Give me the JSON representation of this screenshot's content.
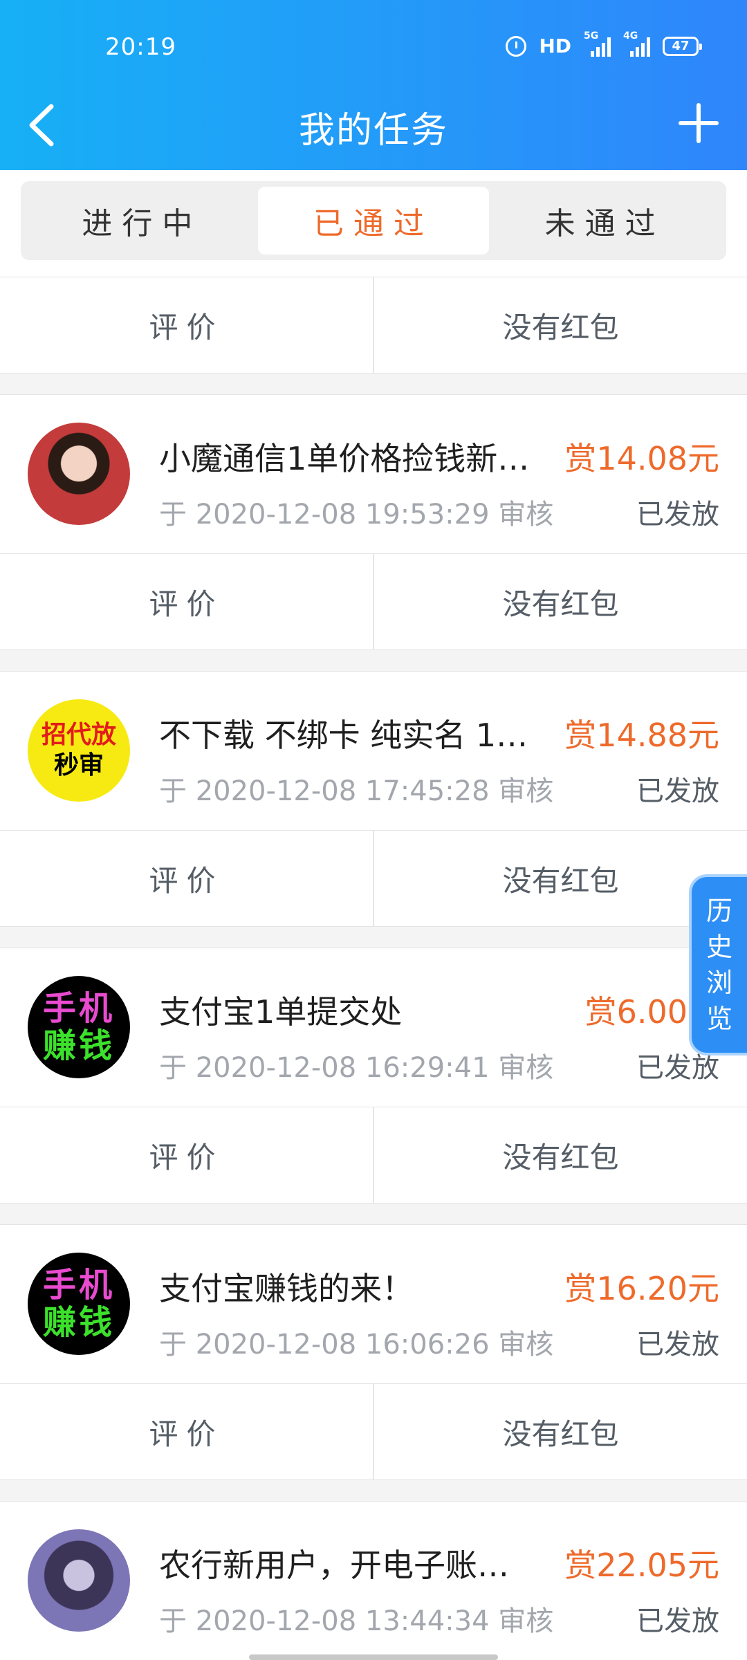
{
  "status": {
    "time": "20:19",
    "hd": "HD",
    "net1": "5G",
    "net2": "4G",
    "battery": "47"
  },
  "header": {
    "title": "我的任务"
  },
  "tabs": [
    {
      "label": "进行中",
      "active": false
    },
    {
      "label": "已通过",
      "active": true
    },
    {
      "label": "未通过",
      "active": false
    }
  ],
  "actions": {
    "rate": "评价",
    "no_redpacket": "没有红包"
  },
  "tasks": [
    {
      "title": "小魔通信1单价格捡钱新…",
      "reward": "赏14.08元",
      "subtitle": "于 2020-12-08 19:53:29 审核",
      "state": "已发放",
      "avatar_icon": "person-photo-avatar"
    },
    {
      "title": "不下载 不绑卡 纯实名 1…",
      "reward": "赏14.88元",
      "subtitle": "于 2020-12-08 17:45:28 审核",
      "state": "已发放",
      "avatar_icon": "text-badge-avatar",
      "avatar_text": [
        "招代放",
        "秒审"
      ]
    },
    {
      "title": "支付宝1单提交处",
      "reward": "赏6.00元",
      "subtitle": "于 2020-12-08 16:29:41 审核",
      "state": "已发放",
      "avatar_icon": "text-badge-avatar",
      "avatar_text": [
        "手机",
        "赚钱"
      ]
    },
    {
      "title": "支付宝赚钱的来！",
      "reward": "赏16.20元",
      "subtitle": "于 2020-12-08 16:06:26 审核",
      "state": "已发放",
      "avatar_icon": "text-badge-avatar",
      "avatar_text": [
        "手机",
        "赚钱"
      ]
    },
    {
      "title": "农行新用户，开电子账…",
      "reward": "赏22.05元",
      "subtitle": "于 2020-12-08 13:44:34 审核",
      "state": "已发放",
      "avatar_icon": "person-photo-avatar"
    }
  ],
  "float_button": {
    "label": "历史浏览",
    "chars": [
      "历",
      "史",
      "浏",
      "览"
    ]
  },
  "colors": {
    "accent": "#ee6a2b",
    "header_start": "#17b0f6",
    "header_end": "#2f86fb",
    "float_button": "#2d8ff5"
  }
}
